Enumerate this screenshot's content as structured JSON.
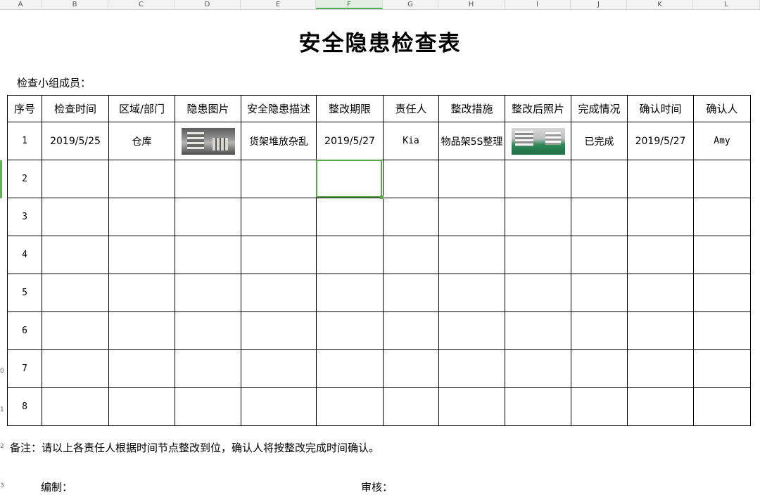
{
  "columns": [
    "A",
    "B",
    "C",
    "D",
    "E",
    "F",
    "G",
    "H",
    "I",
    "J",
    "K",
    "L"
  ],
  "selected_column": "F",
  "row_numbers": [
    "0",
    "1",
    "2",
    "3"
  ],
  "title": "安全隐患检查表",
  "members_label": "检查小组成员：",
  "table": {
    "headers": [
      "序号",
      "检查时间",
      "区域/部门",
      "隐患图片",
      "安全隐患描述",
      "整改期限",
      "责任人",
      "整改措施",
      "整改后照片",
      "完成情况",
      "确认时间",
      "确认人"
    ],
    "first_row": {
      "no": "1",
      "check_time": "2019/5/25",
      "area": "仓库",
      "hazard_photo": "hazard-photo",
      "description": "货架堆放杂乱",
      "deadline": "2019/5/27",
      "owner": "Kia",
      "measure": "物品架5S整理",
      "after_photo": "after-photo",
      "status": "已完成",
      "confirm_time": "2019/5/27",
      "confirmer": "Amy"
    },
    "empty_rows": [
      "2",
      "3",
      "4",
      "5",
      "6",
      "7",
      "8"
    ]
  },
  "note": "备注：请以上各责任人根据时间节点整改到位，确认人将按整改完成时间确认。",
  "editor_label": "编制：",
  "reviewer_label": "审核：",
  "colors": {
    "selection": "#5aa64a",
    "header_bg": "#f3f3f3"
  }
}
